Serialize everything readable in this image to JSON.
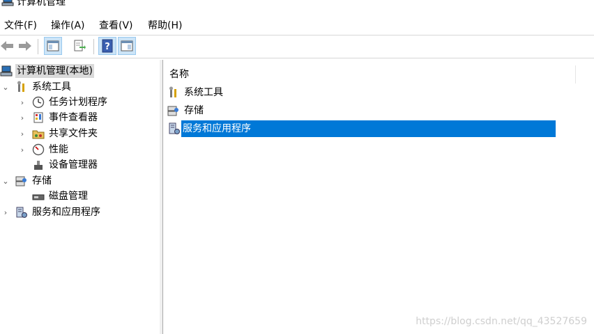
{
  "window": {
    "title": "计算机管理"
  },
  "menu": [
    {
      "label": "文件(F)"
    },
    {
      "label": "操作(A)"
    },
    {
      "label": "查看(V)"
    },
    {
      "label": "帮助(H)"
    }
  ],
  "toolbar": {
    "icons": [
      "back-arrow-icon",
      "forward-arrow-icon",
      "show-hide-tree-icon",
      "export-list-icon",
      "help-icon",
      "show-action-pane-icon"
    ]
  },
  "tree": {
    "root": "计算机管理(本地)",
    "system_tools": "系统工具",
    "task_scheduler": "任务计划程序",
    "event_viewer": "事件查看器",
    "shared_folders": "共享文件夹",
    "performance": "性能",
    "device_manager": "设备管理器",
    "storage": "存储",
    "disk_management": "磁盘管理",
    "services_apps": "服务和应用程序"
  },
  "list": {
    "column_name": "名称",
    "rows": [
      "系统工具",
      "存储",
      "服务和应用程序"
    ]
  },
  "watermark": "https://blog.csdn.net/qq_43527659",
  "colors": {
    "selection": "#0078d7",
    "tree_selection": "#d9d9d9"
  }
}
